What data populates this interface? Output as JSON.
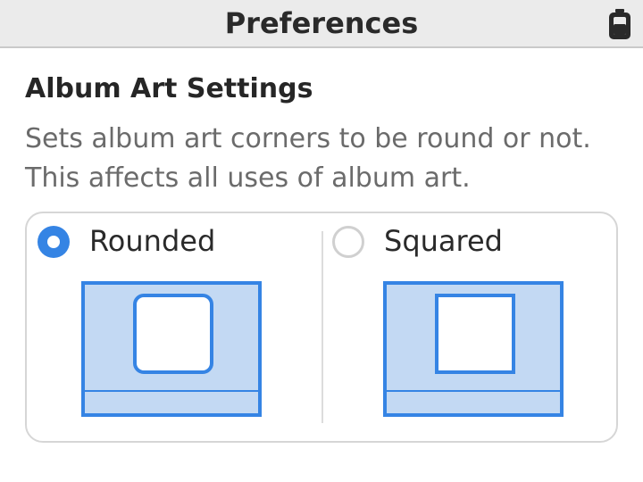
{
  "window": {
    "title": "Preferences",
    "status_icon": "battery-icon"
  },
  "section": {
    "title": "Album Art Settings",
    "description": "Sets album art corners to be round or not. This affects all uses of album art."
  },
  "options": [
    {
      "label": "Rounded",
      "selected": true,
      "icon": "rounded-album-preview-icon"
    },
    {
      "label": "Squared",
      "selected": false,
      "icon": "squared-album-preview-icon"
    }
  ],
  "colors": {
    "accent": "#3584e4",
    "preview_fill": "#c3d9f3",
    "titlebar_bg": "#ebebeb"
  }
}
